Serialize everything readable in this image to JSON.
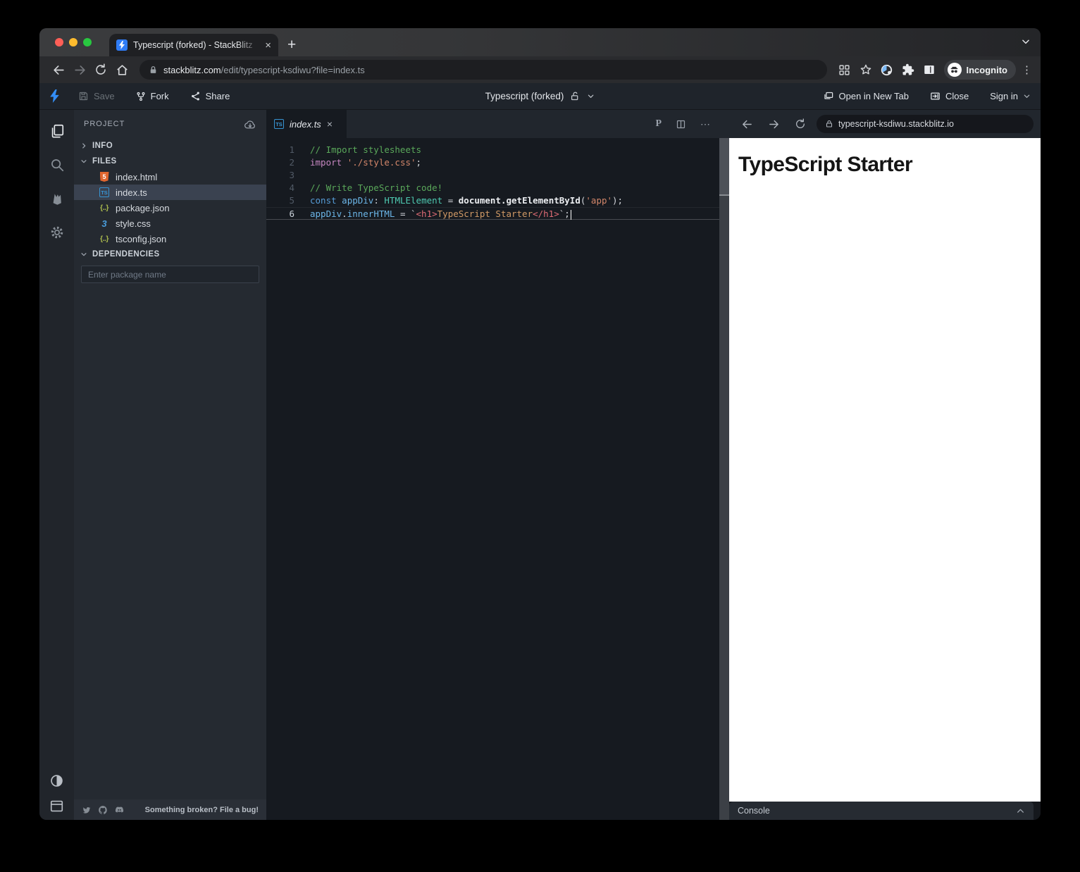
{
  "browser": {
    "tab": {
      "title": "Typescript (forked) - StackBlitz"
    },
    "url": {
      "domain": "stackblitz.com",
      "path": "/edit/typescript-ksdiwu?file=index.ts"
    },
    "incognito_label": "Incognito"
  },
  "header": {
    "save_label": "Save",
    "fork_label": "Fork",
    "share_label": "Share",
    "project_title": "Typescript (forked)",
    "open_in_new_tab_label": "Open in New Tab",
    "close_label": "Close",
    "sign_in_label": "Sign in"
  },
  "explorer": {
    "project_label": "PROJECT",
    "sections": {
      "info": "INFO",
      "files": "FILES",
      "dependencies": "DEPENDENCIES"
    },
    "files": [
      {
        "name": "index.html",
        "type": "html"
      },
      {
        "name": "index.ts",
        "type": "ts",
        "selected": true
      },
      {
        "name": "package.json",
        "type": "json"
      },
      {
        "name": "style.css",
        "type": "css"
      },
      {
        "name": "tsconfig.json",
        "type": "json"
      }
    ],
    "package_input_placeholder": "Enter package name",
    "bug_text": "Something broken? File a bug!"
  },
  "editor": {
    "tab_label": "index.ts",
    "code": {
      "lines": [
        {
          "num": 1,
          "tokens": [
            {
              "t": "// Import stylesheets",
              "c": "cmt"
            }
          ]
        },
        {
          "num": 2,
          "tokens": [
            {
              "t": "import",
              "c": "kw2"
            },
            {
              "t": " ",
              "c": "pln"
            },
            {
              "t": "'./style.css'",
              "c": "str"
            },
            {
              "t": ";",
              "c": "pln"
            }
          ]
        },
        {
          "num": 3,
          "tokens": []
        },
        {
          "num": 4,
          "tokens": [
            {
              "t": "// Write TypeScript code!",
              "c": "cmt"
            }
          ]
        },
        {
          "num": 5,
          "tokens": [
            {
              "t": "const",
              "c": "kw"
            },
            {
              "t": " ",
              "c": "pln"
            },
            {
              "t": "appDiv",
              "c": "var"
            },
            {
              "t": ": ",
              "c": "pln"
            },
            {
              "t": "HTMLElement",
              "c": "type"
            },
            {
              "t": " = ",
              "c": "pln"
            },
            {
              "t": "document.getElementById",
              "c": "fn"
            },
            {
              "t": "(",
              "c": "pln"
            },
            {
              "t": "'app'",
              "c": "str"
            },
            {
              "t": ");",
              "c": "pln"
            }
          ]
        },
        {
          "num": 6,
          "current": true,
          "tokens": [
            {
              "t": "appDiv",
              "c": "var"
            },
            {
              "t": ".",
              "c": "pln"
            },
            {
              "t": "innerHTML",
              "c": "var"
            },
            {
              "t": " = ",
              "c": "pln"
            },
            {
              "t": "`",
              "c": "pln"
            },
            {
              "t": "<h1>",
              "c": "tag"
            },
            {
              "t": "TypeScript Starter",
              "c": "str2"
            },
            {
              "t": "</h1>",
              "c": "tag"
            },
            {
              "t": "`",
              "c": "pln"
            },
            {
              "t": ";",
              "c": "pln"
            },
            {
              "c": "cursor"
            }
          ]
        }
      ]
    }
  },
  "preview": {
    "url": "typescript-ksdiwu.stackblitz.io",
    "heading": "TypeScript Starter",
    "console_label": "Console"
  },
  "icons": {
    "tab_close": "×",
    "new_tab": "+",
    "kebab": "⋮",
    "more": "⋯",
    "prettier": "P",
    "editor_tab_close": "×",
    "ts_badge": "TS",
    "html_badge": "5",
    "json_badge": "{..}",
    "css_badge": "3"
  },
  "colors": {
    "accent_blue": "#338ef7",
    "selection_bg": "#3a4250",
    "comment_green": "#5aa85a",
    "keyword_blue": "#569cd6",
    "import_magenta": "#c586c0",
    "string_orange": "#d4876a",
    "variable_blue": "#6cb6e8",
    "type_teal": "#4ec9b0",
    "tag_red": "#e06c75",
    "template_text_orange": "#d19a66"
  }
}
